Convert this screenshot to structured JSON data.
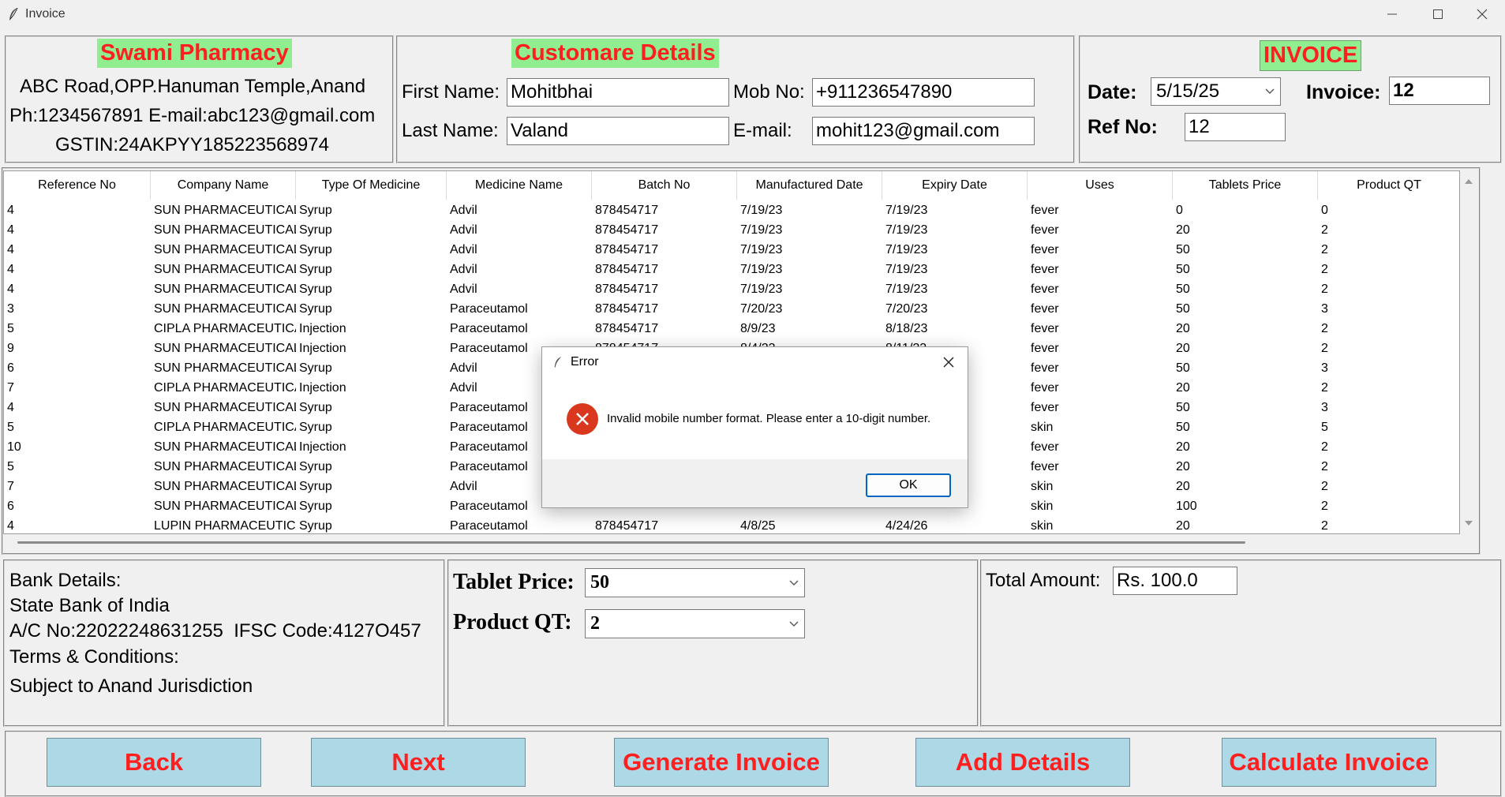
{
  "window": {
    "title": "Invoice"
  },
  "shop": {
    "name": "Swami Pharmacy",
    "address": "ABC Road,OPP.Hanuman Temple,Anand",
    "contact": "Ph:1234567891 E-mail:abc123@gmail.com",
    "gstin": "GSTIN:24AKPYY185223568974"
  },
  "customer": {
    "heading": "Customare Details",
    "first_name_label": "First Name:",
    "first_name_value": "Mohitbhai",
    "last_name_label": "Last Name:",
    "last_name_value": "Valand",
    "mob_label": "Mob No:",
    "mob_value": "+911236547890",
    "email_label": "E-mail:",
    "email_value": "mohit123@gmail.com"
  },
  "invoice": {
    "heading": "INVOICE",
    "date_label": "Date:",
    "date_value": "5/15/25",
    "invoice_label": "Invoice:",
    "invoice_value": "12",
    "ref_label": "Ref No:",
    "ref_value": "12"
  },
  "table": {
    "columns": [
      "Reference No",
      "Company Name",
      "Type Of Medicine",
      "Medicine Name",
      "Batch No",
      "Manufactured Date",
      "Expiry Date",
      "Uses",
      "Tablets Price",
      "Product QT"
    ],
    "rows": [
      [
        "4",
        "SUN PHARMACEUTICAL",
        "Syrup",
        "Advil",
        "878454717",
        "7/19/23",
        "7/19/23",
        "fever",
        "0",
        "0"
      ],
      [
        "4",
        "SUN PHARMACEUTICAL",
        "Syrup",
        "Advil",
        "878454717",
        "7/19/23",
        "7/19/23",
        "fever",
        "20",
        "2"
      ],
      [
        "4",
        "SUN PHARMACEUTICAL",
        "Syrup",
        "Advil",
        "878454717",
        "7/19/23",
        "7/19/23",
        "fever",
        "50",
        "2"
      ],
      [
        "4",
        "SUN PHARMACEUTICAL",
        "Syrup",
        "Advil",
        "878454717",
        "7/19/23",
        "7/19/23",
        "fever",
        "50",
        "2"
      ],
      [
        "4",
        "SUN PHARMACEUTICAL",
        "Syrup",
        "Advil",
        "878454717",
        "7/19/23",
        "7/19/23",
        "fever",
        "50",
        "2"
      ],
      [
        "3",
        "SUN PHARMACEUTICAL",
        "Syrup",
        "Paraceutamol",
        "878454717",
        "7/20/23",
        "7/20/23",
        "fever",
        "50",
        "3"
      ],
      [
        "5",
        "CIPLA PHARMACEUTICA",
        "Injection",
        "Paraceutamol",
        "878454717",
        "8/9/23",
        "8/18/23",
        "fever",
        "20",
        "2"
      ],
      [
        "9",
        "SUN PHARMACEUTICAL",
        "Injection",
        "Paraceutamol",
        "878454717",
        "8/4/23",
        "8/11/23",
        "fever",
        "20",
        "2"
      ],
      [
        "6",
        "SUN PHARMACEUTICAL",
        "Syrup",
        "Advil",
        "",
        "",
        "",
        "fever",
        "50",
        "3"
      ],
      [
        "7",
        "CIPLA PHARMACEUTICA",
        "Injection",
        "Advil",
        "",
        "",
        "",
        "fever",
        "20",
        "2"
      ],
      [
        "4",
        "SUN PHARMACEUTICAL",
        "Syrup",
        "Paraceutamol",
        "",
        "",
        "",
        "fever",
        "50",
        "3"
      ],
      [
        "5",
        "CIPLA PHARMACEUTICA",
        "Syrup",
        "Paraceutamol",
        "",
        "",
        "",
        "skin",
        "50",
        "5"
      ],
      [
        "10",
        "SUN PHARMACEUTICAL",
        "Injection",
        "Paraceutamol",
        "",
        "",
        "",
        "fever",
        "20",
        "2"
      ],
      [
        "5",
        "SUN PHARMACEUTICAL",
        "Syrup",
        "Paraceutamol",
        "",
        "",
        "",
        "fever",
        "20",
        "2"
      ],
      [
        "7",
        "SUN PHARMACEUTICAL",
        "Syrup",
        "Advil",
        "",
        "",
        "",
        "skin",
        "20",
        "2"
      ],
      [
        "6",
        "SUN PHARMACEUTICAL",
        "Syrup",
        "Paraceutamol",
        "",
        "",
        "",
        "skin",
        "100",
        "2"
      ],
      [
        "4",
        "LUPIN PHARMACEUTICA",
        "Syrup",
        "Paraceutamol",
        "878454717",
        "4/8/25",
        "4/24/26",
        "skin",
        "20",
        "2"
      ]
    ]
  },
  "bank": {
    "title": "Bank Details:",
    "bank_name": "State Bank of India",
    "account": "A/C No:22022248631255  IFSC Code:4127O457",
    "terms_title": "Terms & Conditions:",
    "terms_text": "Subject to Anand Jurisdiction"
  },
  "pricing": {
    "tablet_price_label": "Tablet Price:",
    "tablet_price_value": "50",
    "product_qt_label": "Product QT:",
    "product_qt_value": "2"
  },
  "total": {
    "label": "Total Amount:",
    "value": "Rs. 100.0"
  },
  "buttons": {
    "back": "Back",
    "next": "Next",
    "generate": "Generate Invoice",
    "add": "Add Details",
    "calculate": "Calculate Invoice"
  },
  "dialog": {
    "title": "Error",
    "message": "Invalid mobile number format. Please enter a 10-digit number.",
    "ok": "OK"
  },
  "colors": {
    "heading_bg": "#90ee90",
    "heading_fg": "#ff1f1f",
    "button_bg": "#add8e6",
    "error_icon": "#d9381e"
  }
}
